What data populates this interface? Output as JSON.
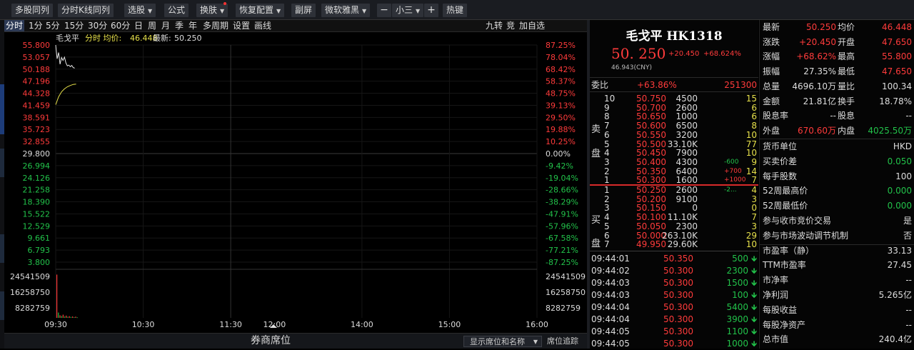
{
  "toolbar": {
    "multi_stock": "多股同列",
    "kline_multi": "分时K线同列",
    "pick_stock": "选股",
    "formula": "公式",
    "skin": "换肤",
    "restore": "恢复配置",
    "sub_screen": "副屏",
    "font": "微软雅黑",
    "minus": "−",
    "size": "小三",
    "plus": "+",
    "hotkey": "热键"
  },
  "period_tabs": [
    "分时",
    "1分",
    "5分",
    "15分",
    "30分",
    "60分",
    "日",
    "周",
    "月",
    "季",
    "年",
    "多周期",
    "设置",
    "画线"
  ],
  "right_tabs": [
    "九转",
    "竞",
    "加自选"
  ],
  "chart_data": {
    "type": "line",
    "legend": {
      "name": "毛戈平",
      "avg_label": "分时 均价:",
      "avg_value": "46.448",
      "last_label": "最新:",
      "last_value": "50.250"
    },
    "prev_close": 29.8,
    "ylim": [
      3.8,
      55.8
    ],
    "price_ticks": [
      "55.800",
      "53.057",
      "50.188",
      "47.196",
      "44.328",
      "41.459",
      "38.591",
      "35.723",
      "32.855",
      "29.800",
      "26.994",
      "24.126",
      "21.258",
      "18.390",
      "15.522",
      "12.529",
      "9.661",
      "6.793",
      "3.800"
    ],
    "pct_ticks": [
      "87.25%",
      "78.04%",
      "68.42%",
      "58.37%",
      "48.75%",
      "39.13%",
      "29.50%",
      "19.88%",
      "10.25%",
      "0.00%",
      "-9.42%",
      "-19.04%",
      "-28.66%",
      "-38.29%",
      "-47.91%",
      "-57.96%",
      "-67.58%",
      "-77.21%",
      "-87.25%"
    ],
    "volume_ticks": [
      "24541509",
      "16258750",
      "8282759"
    ],
    "volume_ylim": [
      0,
      32000000
    ],
    "time_labels": [
      "09:30",
      "10:30",
      "11:30",
      "12:00",
      "14:00",
      "15:00",
      "16:00"
    ],
    "price_series": [
      {
        "t": 0,
        "v": 55.8
      },
      {
        "t": 1,
        "v": 52.5
      },
      {
        "t": 2,
        "v": 54.0
      },
      {
        "t": 3,
        "v": 51.2
      },
      {
        "t": 4,
        "v": 52.8
      },
      {
        "t": 5,
        "v": 52.1
      },
      {
        "t": 6,
        "v": 52.9
      },
      {
        "t": 7,
        "v": 51.5
      },
      {
        "t": 8,
        "v": 50.8
      },
      {
        "t": 9,
        "v": 51.0
      },
      {
        "t": 10,
        "v": 50.6
      },
      {
        "t": 11,
        "v": 50.9
      },
      {
        "t": 12,
        "v": 50.4
      },
      {
        "t": 13,
        "v": 50.25
      }
    ],
    "avg_series": [
      {
        "t": 0,
        "v": 41.5
      },
      {
        "t": 2,
        "v": 43.4
      },
      {
        "t": 4,
        "v": 44.6
      },
      {
        "t": 6,
        "v": 45.3
      },
      {
        "t": 8,
        "v": 45.8
      },
      {
        "t": 10,
        "v": 46.1
      },
      {
        "t": 12,
        "v": 46.35
      },
      {
        "t": 14,
        "v": 46.448
      }
    ],
    "volume_series": [
      28500000,
      3500000,
      1700000,
      1200000,
      2100000,
      900000,
      1500000,
      700000,
      1100000,
      600000,
      900000,
      500000,
      800000,
      400000
    ]
  },
  "bottom": {
    "title": "券商席位",
    "select": "显示席位和名称",
    "track": "席位追踪"
  },
  "quote": {
    "name": "毛戈平 HK1318",
    "price": "50. 250",
    "change": "+20.450",
    "change_pct": "+68.624%",
    "cny": "46.943(CNY)",
    "weibi_label": "委比",
    "weibi_value": "+63.86%",
    "weibi_diff": "251300",
    "sell_label": [
      "卖",
      "盘"
    ],
    "buy_label": [
      "买",
      "盘"
    ],
    "asks": [
      {
        "lvl": "10",
        "price": "50.750",
        "vol": "4500",
        "chg": "",
        "cnt": "15"
      },
      {
        "lvl": "9",
        "price": "50.700",
        "vol": "2600",
        "chg": "",
        "cnt": "6"
      },
      {
        "lvl": "8",
        "price": "50.650",
        "vol": "1000",
        "chg": "",
        "cnt": "6"
      },
      {
        "lvl": "7",
        "price": "50.600",
        "vol": "6500",
        "chg": "",
        "cnt": "8"
      },
      {
        "lvl": "6",
        "price": "50.550",
        "vol": "3200",
        "chg": "",
        "cnt": "10"
      },
      {
        "lvl": "5",
        "price": "50.500",
        "vol": "33.10K",
        "chg": "",
        "cnt": "77"
      },
      {
        "lvl": "4",
        "price": "50.450",
        "vol": "7900",
        "chg": "",
        "cnt": "10"
      },
      {
        "lvl": "3",
        "price": "50.400",
        "vol": "4300",
        "chg": "-600",
        "cnt": "9"
      },
      {
        "lvl": "2",
        "price": "50.350",
        "vol": "6400",
        "chg": "+700",
        "cnt": "14"
      },
      {
        "lvl": "1",
        "price": "50.300",
        "vol": "1600",
        "chg": "+1000",
        "cnt": "7"
      }
    ],
    "bids": [
      {
        "lvl": "1",
        "price": "50.250",
        "vol": "2600",
        "chg": "-2...",
        "cnt": "4"
      },
      {
        "lvl": "2",
        "price": "50.200",
        "vol": "9100",
        "chg": "",
        "cnt": "3"
      },
      {
        "lvl": "3",
        "price": "50.150",
        "vol": "0",
        "chg": "",
        "cnt": "0"
      },
      {
        "lvl": "4",
        "price": "50.100",
        "vol": "11.10K",
        "chg": "",
        "cnt": "7"
      },
      {
        "lvl": "5",
        "price": "50.050",
        "vol": "2300",
        "chg": "",
        "cnt": "3"
      },
      {
        "lvl": "6",
        "price": "50.000",
        "vol": "263.10K",
        "chg": "",
        "cnt": "29"
      },
      {
        "lvl": "7",
        "price": "49.950",
        "vol": "29.60K",
        "chg": "",
        "cnt": "10"
      }
    ],
    "ticks": [
      {
        "time": "09:44:01",
        "price": "50.350",
        "vol": "500"
      },
      {
        "time": "09:44:02",
        "price": "50.300",
        "vol": "2300"
      },
      {
        "time": "09:44:03",
        "price": "50.300",
        "vol": "1500"
      },
      {
        "time": "09:44:03",
        "price": "50.300",
        "vol": "100"
      },
      {
        "time": "09:44:04",
        "price": "50.300",
        "vol": "5400"
      },
      {
        "time": "09:44:04",
        "price": "50.300",
        "vol": "3900"
      },
      {
        "time": "09:44:05",
        "price": "50.300",
        "vol": "1100"
      },
      {
        "time": "09:44:05",
        "price": "50.300",
        "vol": "1000"
      }
    ]
  },
  "info": {
    "pairs": [
      {
        "l1": "最新",
        "v1": "50.250",
        "c1": "red",
        "l2": "均价",
        "v2": "46.448",
        "c2": "red"
      },
      {
        "l1": "涨跌",
        "v1": "+20.450",
        "c1": "red",
        "l2": "开盘",
        "v2": "47.650",
        "c2": "red"
      },
      {
        "l1": "涨幅",
        "v1": "+68.62%",
        "c1": "red",
        "l2": "最高",
        "v2": "55.800",
        "c2": "red"
      },
      {
        "l1": "振幅",
        "v1": "27.35%",
        "c1": "white",
        "l2": "最低",
        "v2": "47.650",
        "c2": "red"
      },
      {
        "l1": "总量",
        "v1": "4696.10万",
        "c1": "white",
        "l2": "量比",
        "v2": "100.34",
        "c2": "white"
      },
      {
        "l1": "金额",
        "v1": "21.81亿",
        "c1": "white",
        "l2": "换手",
        "v2": "18.78%",
        "c2": "white"
      },
      {
        "l1": "股息率",
        "v1": "--",
        "c1": "white",
        "l2": "股息",
        "v2": "--",
        "c2": "white"
      },
      {
        "l1": "外盘",
        "v1": "670.60万",
        "c1": "red",
        "l2": "内盘",
        "v2": "4025.50万",
        "c2": "green"
      }
    ],
    "singles": [
      {
        "l": "货币单位",
        "v": "HKD",
        "c": "white"
      },
      {
        "l": "买卖价差",
        "v": "0.050",
        "c": "green"
      },
      {
        "l": "每手股数",
        "v": "100",
        "c": "white"
      },
      {
        "l": "52周最高价",
        "v": "0.000",
        "c": "green"
      },
      {
        "l": "52周最低价",
        "v": "0.000",
        "c": "green"
      },
      {
        "l": "参与收市竞价交易",
        "v": "是",
        "c": "white"
      },
      {
        "l": "参与市场波动调节机制",
        "v": "否",
        "c": "white"
      },
      {
        "l": "市盈率（静）",
        "v": "33.13",
        "c": "white"
      },
      {
        "l": "TTM市盈率",
        "v": "27.45",
        "c": "white"
      },
      {
        "l": "市净率",
        "v": "--",
        "c": "white"
      },
      {
        "l": "净利润",
        "v": "5.265亿",
        "c": "white"
      },
      {
        "l": "每股收益",
        "v": "--",
        "c": "white"
      },
      {
        "l": "每股净资产",
        "v": "--",
        "c": "white"
      },
      {
        "l": "总市值",
        "v": "240.4亿",
        "c": "white"
      }
    ]
  },
  "colors": {
    "up": "#ff3b3b",
    "down": "#22c24a",
    "price_line": "#e8e8e8",
    "avg_line": "#e6e04a",
    "label": "#ddd"
  }
}
